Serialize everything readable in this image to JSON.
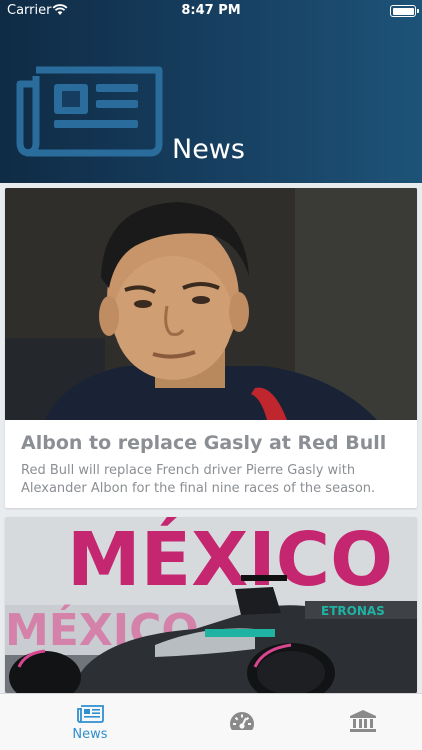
{
  "status_bar": {
    "carrier": "Carrier",
    "time": "8:47 PM"
  },
  "header": {
    "title": "News",
    "icon": "newspaper-icon"
  },
  "articles": [
    {
      "title": "Albon to replace Gasly at Red Bull",
      "summary": "Red Bull will replace French driver Pierre Gasly with Alexander Albon for the final nine races of the season.",
      "image": "driver-portrait-photo"
    },
    {
      "image": "mexico-race-car-photo",
      "image_text": "MÉXICO"
    }
  ],
  "tab_bar": {
    "tabs": [
      {
        "label": "News",
        "icon": "newspaper-icon",
        "selected": true
      },
      {
        "label": "",
        "icon": "speedometer-icon",
        "selected": false
      },
      {
        "label": "",
        "icon": "bank-icon",
        "selected": false
      }
    ]
  },
  "colors": {
    "header_dark": "#0f2b45",
    "header_light": "#1d5378",
    "accent": "#2f8fd1",
    "text_gray": "#8b8f93"
  }
}
